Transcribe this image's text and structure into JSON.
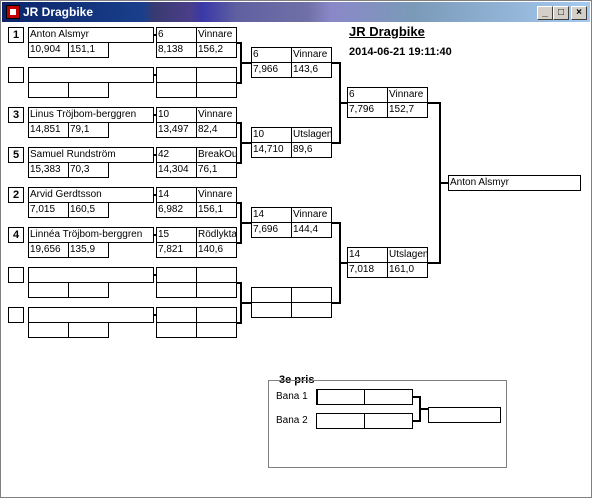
{
  "window": {
    "title": "JR Dragbike",
    "buttons": [
      "_",
      "□",
      "×"
    ]
  },
  "header": {
    "title": "JR Dragbike",
    "datetime": "2014-06-21 19:11:40"
  },
  "round1": [
    {
      "seed": "1",
      "name": "Anton Alsmyr",
      "time": "10,904",
      "speed": "151,1"
    },
    {
      "seed": "",
      "name": "",
      "time": "",
      "speed": ""
    },
    {
      "seed": "3",
      "name": "Linus Tröjbom-berggren",
      "time": "14,851",
      "speed": "79,1"
    },
    {
      "seed": "5",
      "name": "Samuel Rundström",
      "time": "15,383",
      "speed": "70,3"
    },
    {
      "seed": "2",
      "name": "Arvid Gerdtsson",
      "time": "7,015",
      "speed": "160,5"
    },
    {
      "seed": "4",
      "name": "Linnéa Tröjbom-berggren",
      "time": "19,656",
      "speed": "135,9"
    },
    {
      "seed": "",
      "name": "",
      "time": "",
      "speed": ""
    },
    {
      "seed": "",
      "name": "",
      "time": "",
      "speed": ""
    }
  ],
  "round2": [
    {
      "num": "6",
      "result": "Vinnare",
      "time": "8,138",
      "speed": "156,2"
    },
    {
      "num": "",
      "result": "",
      "time": "",
      "speed": ""
    },
    {
      "num": "10",
      "result": "Vinnare",
      "time": "13,497",
      "speed": "82,4"
    },
    {
      "num": "42",
      "result": "BreakOut",
      "time": "14,304",
      "speed": "76,1"
    },
    {
      "num": "14",
      "result": "Vinnare",
      "time": "6,982",
      "speed": "156,1"
    },
    {
      "num": "15",
      "result": "Rödlykta",
      "time": "7,821",
      "speed": "140,6"
    },
    {
      "num": "",
      "result": "",
      "time": "",
      "speed": ""
    },
    {
      "num": "",
      "result": "",
      "time": "",
      "speed": ""
    }
  ],
  "round3": [
    {
      "num": "6",
      "result": "Vinnare",
      "time": "7,966",
      "speed": "143,6"
    },
    {
      "num": "10",
      "result": "Utslagen",
      "time": "14,710",
      "speed": "89,6"
    },
    {
      "num": "14",
      "result": "Vinnare",
      "time": "7,696",
      "speed": "144,4"
    },
    {
      "num": "",
      "result": "",
      "time": "",
      "speed": ""
    }
  ],
  "semis": [
    {
      "num": "6",
      "result": "Vinnare",
      "time": "7,796",
      "speed": "152,7"
    },
    {
      "num": "14",
      "result": "Utslagen",
      "time": "7,018",
      "speed": "161,0"
    }
  ],
  "winner": {
    "name": "Anton Alsmyr"
  },
  "third_place": {
    "title": "3e pris",
    "lane1_label": "Bana 1",
    "lane2_label": "Bana 2",
    "lane1": {
      "a": "",
      "b": ""
    },
    "lane2": {
      "a": "",
      "b": ""
    },
    "result": ""
  }
}
